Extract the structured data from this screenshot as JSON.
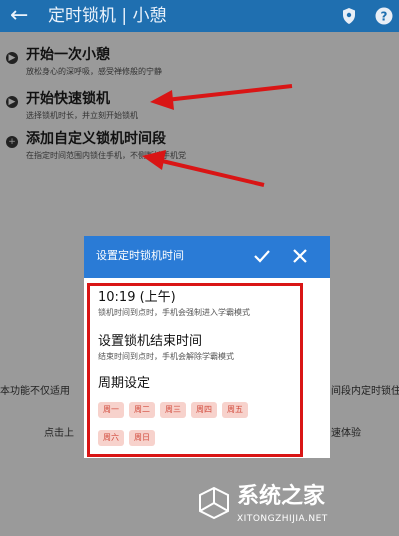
{
  "appbar": {
    "back_icon": "arrow-left",
    "title": "定时锁机 | 小憩",
    "icons": [
      "location-shield-icon",
      "help-icon"
    ]
  },
  "list": {
    "items": [
      {
        "title": "开始一次小憩",
        "subtitle": "放松身心的深呼吸，感受禅修般的宁静",
        "icon": "play-icon"
      },
      {
        "title": "开始快速锁机",
        "subtitle": "选择锁机时长，并立刻开始锁机",
        "icon": "play-icon"
      },
      {
        "title": "添加自定义锁机时间段",
        "subtitle": "在指定时间范围内锁住手机，不侧断按手机党",
        "icon": "add-icon"
      }
    ]
  },
  "background_fragments": {
    "left_line1": "本功能不仅适用",
    "right_line1": "间段内定时锁住",
    "left_line2": "点击上",
    "right_line2": "速体验"
  },
  "dialog": {
    "title": "设置定时锁机时间",
    "confirm_icon": "check-icon",
    "close_icon": "close-icon",
    "start": {
      "value": "10:19 (上午)",
      "hint": "锁机时间到点时，手机会强制进入学霸模式"
    },
    "end": {
      "value": "设置锁机结束时间",
      "hint": "结束时间到点时，手机会解除学霸模式"
    },
    "period": {
      "label": "周期设定",
      "days": [
        "周一",
        "周二",
        "周三",
        "周四",
        "周五",
        "周六",
        "周日"
      ]
    }
  },
  "watermark": {
    "name": "系统之家",
    "url": "XITONGZHIJIA.NET"
  },
  "colors": {
    "appbar": "#1f6fb0",
    "dialog_header": "#2a7bd6",
    "annotation": "#d91515",
    "chip_bg": "#f7d2cc",
    "chip_text": "#d24b3d",
    "overlay": "#9a9a9a"
  }
}
